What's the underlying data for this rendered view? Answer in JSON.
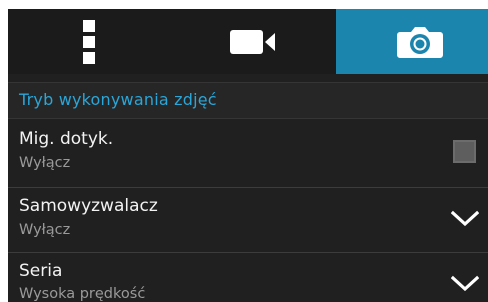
{
  "tabs": [
    {
      "icon": "more-vertical-icon",
      "selected": false
    },
    {
      "icon": "video-camera-icon",
      "selected": false
    },
    {
      "icon": "camera-icon",
      "selected": true
    }
  ],
  "section": {
    "title": "Tryb wykonywania zdjęć"
  },
  "settings": [
    {
      "title": "Mig. dotyk.",
      "value": "Wyłącz",
      "control": "checkbox",
      "checked": false
    },
    {
      "title": "Samowyzwalacz",
      "value": "Wyłącz",
      "control": "dropdown"
    },
    {
      "title": "Seria",
      "value": "Wysoka prędkość",
      "control": "dropdown"
    }
  ],
  "colors": {
    "accent": "#1c85ad",
    "section_text": "#2aa6d8",
    "background": "#202020"
  }
}
